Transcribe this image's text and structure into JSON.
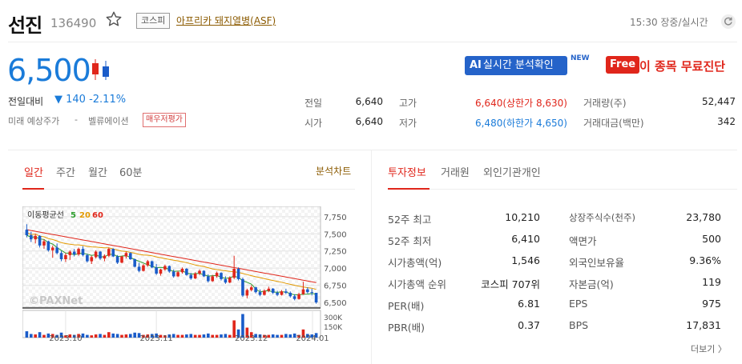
{
  "header": {
    "name": "선진",
    "code": "136490",
    "market": "코스피",
    "theme": "아프리카 돼지열병(ASF)",
    "time": "15:30 장중/실시간"
  },
  "price": {
    "current": "6,500",
    "change_label": "전일대비",
    "change_value": "▼ 140 -2.11%",
    "mirae_label": "미래 예상주가",
    "mirae_value": "-",
    "valuation_label": "벨류에이션",
    "evaluation_badge": "매우저평가"
  },
  "promo": {
    "ai_prefix": "AI",
    "ai_label": "실시간 분석확인",
    "new_tag": "NEW",
    "free_tag": "Free",
    "free_label": "이 종목 무료진단"
  },
  "quote": {
    "prev_label": "전일",
    "prev": "6,640",
    "open_label": "시가",
    "open": "6,640",
    "high_label": "고가",
    "high": "6,640(상한가 8,630)",
    "low_label": "저가",
    "low": "6,480(하한가 4,650)",
    "volume_label": "거래량(주)",
    "volume": "52,447",
    "amount_label": "거래대금(백만)",
    "amount": "342"
  },
  "chart_tabs": [
    "일간",
    "주간",
    "월간",
    "60분"
  ],
  "chart_link": "분석차트",
  "invest_tabs": [
    "투자정보",
    "거래원",
    "외인기관개인"
  ],
  "chart_data": {
    "type": "candlestick",
    "legend_prefix": "이동평균선",
    "ma_labels": [
      "5",
      "20",
      "60"
    ],
    "ma_colors": [
      "#2e9e2e",
      "#e39a00",
      "#e0261b"
    ],
    "yticks": [
      "7,750",
      "7,500",
      "7,250",
      "7,000",
      "6,750",
      "6,500"
    ],
    "ytick_values": [
      7750,
      7500,
      7250,
      7000,
      6750,
      6500
    ],
    "ylim": [
      6430,
      7900
    ],
    "vol_ticks": [
      "300K",
      "150K"
    ],
    "xticks": [
      "2023.10",
      "2023.11",
      "2023.12",
      "2024.01"
    ],
    "watermark": "©PAXNet",
    "ohlc": [
      [
        7560,
        7640,
        7450,
        7480
      ],
      [
        7480,
        7530,
        7380,
        7420
      ],
      [
        7420,
        7500,
        7360,
        7470
      ],
      [
        7470,
        7480,
        7300,
        7330
      ],
      [
        7330,
        7420,
        7280,
        7390
      ],
      [
        7390,
        7400,
        7240,
        7260
      ],
      [
        7260,
        7330,
        7150,
        7300
      ],
      [
        7300,
        7360,
        7200,
        7220
      ],
      [
        7220,
        7250,
        7100,
        7130
      ],
      [
        7130,
        7220,
        7090,
        7190
      ],
      [
        7190,
        7260,
        7120,
        7240
      ],
      [
        7240,
        7280,
        7170,
        7200
      ],
      [
        7200,
        7300,
        7180,
        7280
      ],
      [
        7280,
        7320,
        7170,
        7190
      ],
      [
        7190,
        7210,
        7080,
        7100
      ],
      [
        7100,
        7180,
        7060,
        7160
      ],
      [
        7160,
        7260,
        7140,
        7240
      ],
      [
        7240,
        7250,
        7120,
        7140
      ],
      [
        7140,
        7200,
        7100,
        7180
      ],
      [
        7180,
        7300,
        7160,
        7280
      ],
      [
        7280,
        7290,
        7160,
        7170
      ],
      [
        7170,
        7190,
        7060,
        7080
      ],
      [
        7080,
        7180,
        7070,
        7170
      ],
      [
        7170,
        7240,
        7140,
        7220
      ],
      [
        7220,
        7230,
        7120,
        7130
      ],
      [
        7130,
        7140,
        7010,
        7020
      ],
      [
        7020,
        7080,
        6940,
        6960
      ],
      [
        6960,
        7060,
        6950,
        7040
      ],
      [
        7040,
        7120,
        7020,
        7100
      ],
      [
        7100,
        7110,
        7000,
        7010
      ],
      [
        7010,
        7060,
        6900,
        6920
      ],
      [
        6920,
        6990,
        6890,
        6980
      ],
      [
        6980,
        7050,
        6960,
        7030
      ],
      [
        7030,
        7040,
        6930,
        6950
      ],
      [
        6950,
        6980,
        6860,
        6880
      ],
      [
        6880,
        6960,
        6870,
        6940
      ],
      [
        6940,
        7010,
        6920,
        6990
      ],
      [
        6990,
        7000,
        6890,
        6900
      ],
      [
        6900,
        6930,
        6830,
        6850
      ],
      [
        6850,
        6940,
        6840,
        6920
      ],
      [
        6920,
        6980,
        6900,
        6960
      ],
      [
        6960,
        6970,
        6870,
        6880
      ],
      [
        6880,
        6910,
        6790,
        6810
      ],
      [
        6810,
        6900,
        6800,
        6880
      ],
      [
        6880,
        6950,
        6860,
        6930
      ],
      [
        6930,
        6940,
        6820,
        6840
      ],
      [
        6840,
        6880,
        6770,
        6790
      ],
      [
        6790,
        6880,
        6780,
        6860
      ],
      [
        6860,
        7180,
        6840,
        6990
      ],
      [
        6990,
        7010,
        6820,
        6840
      ],
      [
        6840,
        6860,
        6580,
        6600
      ],
      [
        6600,
        6700,
        6560,
        6680
      ],
      [
        6680,
        6750,
        6660,
        6720
      ],
      [
        6720,
        6730,
        6630,
        6650
      ],
      [
        6650,
        6690,
        6590,
        6610
      ],
      [
        6610,
        6690,
        6600,
        6670
      ],
      [
        6670,
        6730,
        6650,
        6700
      ],
      [
        6700,
        6710,
        6620,
        6640
      ],
      [
        6640,
        6670,
        6590,
        6610
      ],
      [
        6610,
        6680,
        6600,
        6660
      ],
      [
        6660,
        6700,
        6620,
        6640
      ],
      [
        6640,
        6660,
        6570,
        6590
      ],
      [
        6590,
        6620,
        6530,
        6550
      ],
      [
        6550,
        6640,
        6540,
        6620
      ],
      [
        6620,
        6800,
        6610,
        6690
      ],
      [
        6690,
        6720,
        6630,
        6650
      ],
      [
        6650,
        6700,
        6600,
        6640
      ],
      [
        6640,
        6640,
        6480,
        6500
      ]
    ],
    "volume": [
      70,
      40,
      35,
      60,
      30,
      45,
      40,
      30,
      55,
      25,
      35,
      30,
      40,
      45,
      30,
      25,
      35,
      40,
      30,
      60,
      45,
      40,
      30,
      35,
      40,
      55,
      50,
      30,
      35,
      40,
      45,
      30,
      25,
      35,
      40,
      30,
      30,
      35,
      40,
      30,
      30,
      35,
      45,
      30,
      30,
      35,
      40,
      30,
      190,
      90,
      260,
      110,
      60,
      40,
      35,
      30,
      30,
      35,
      30,
      30,
      40,
      35,
      45,
      30,
      90,
      40,
      35,
      50
    ],
    "vol_max": 300
  },
  "invest_info": {
    "left": [
      {
        "label": "52주 최고",
        "value": "10,210"
      },
      {
        "label": "52주 최저",
        "value": "6,410"
      },
      {
        "label": "시가총액(억)",
        "value": "1,546"
      },
      {
        "label": "시가총액 순위",
        "value": "코스피 707위"
      },
      {
        "label": "PER(배)",
        "value": "6.81"
      },
      {
        "label": "PBR(배)",
        "value": "0.37"
      }
    ],
    "right": [
      {
        "label": "상장주식수(천주)",
        "value": "23,780"
      },
      {
        "label": "액면가",
        "value": "500"
      },
      {
        "label": "외국인보유율",
        "value": "9.36%"
      },
      {
        "label": "자본금(억)",
        "value": "119"
      },
      {
        "label": "EPS",
        "value": "975"
      },
      {
        "label": "BPS",
        "value": "17,831"
      }
    ],
    "more": "더보기 〉"
  }
}
